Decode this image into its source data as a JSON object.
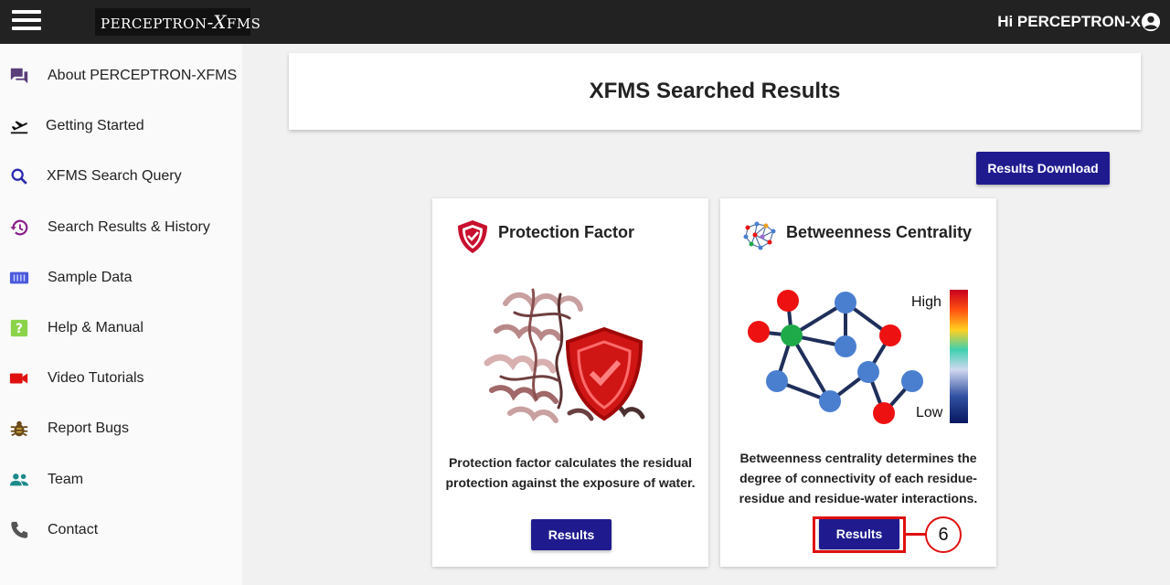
{
  "header": {
    "logo_text_1": "PERCEPTRON",
    "logo_text_2": "-X",
    "logo_text_3": "FMS",
    "greeting": "Hi PERCEPTRON-X"
  },
  "sidebar": {
    "items": [
      {
        "label": "About PERCEPTRON-XFMS",
        "icon": "chat-icon",
        "color": "#5a3e7a"
      },
      {
        "label": "Getting Started",
        "icon": "flight-takeoff-icon",
        "color": "#111111"
      },
      {
        "label": "XFMS Search Query",
        "icon": "search-icon",
        "color": "#2a2ab0"
      },
      {
        "label": "Search Results & History",
        "icon": "history-icon",
        "color": "#8a1f8a"
      },
      {
        "label": "Sample Data",
        "icon": "data-table-icon",
        "color": "#4a5adb"
      },
      {
        "label": "Help & Manual",
        "icon": "help-icon",
        "color": "#8bd44a"
      },
      {
        "label": "Video Tutorials",
        "icon": "video-camera-icon",
        "color": "#e01010"
      },
      {
        "label": "Report Bugs",
        "icon": "bug-icon",
        "color": "#6b4a1a"
      },
      {
        "label": "Team",
        "icon": "team-icon",
        "color": "#1a8a8a"
      },
      {
        "label": "Contact",
        "icon": "phone-icon",
        "color": "#555555"
      }
    ]
  },
  "main": {
    "title": "XFMS Searched Results",
    "download_label": "Results Download",
    "cards": [
      {
        "title": "Protection Factor",
        "icon": "shield-icon",
        "description": "Protection factor calculates the residual protection against the exposure of water.",
        "button": "Results"
      },
      {
        "title": "Betweenness Centrality",
        "icon": "network-icon",
        "description": "Betweenness centrality determines the degree of connectivity of each residue-residue and residue-water interactions.",
        "button": "Results",
        "legend_high": "High",
        "legend_low": "Low"
      }
    ]
  },
  "annotation": {
    "step": "6",
    "color": "#e01010"
  },
  "colors": {
    "topbar": "#222222",
    "button": "#1f1b8f",
    "node_red": "#ee1111",
    "node_blue": "#4a7fd0",
    "node_green": "#1faa4a",
    "edge": "#1f2f5a"
  }
}
